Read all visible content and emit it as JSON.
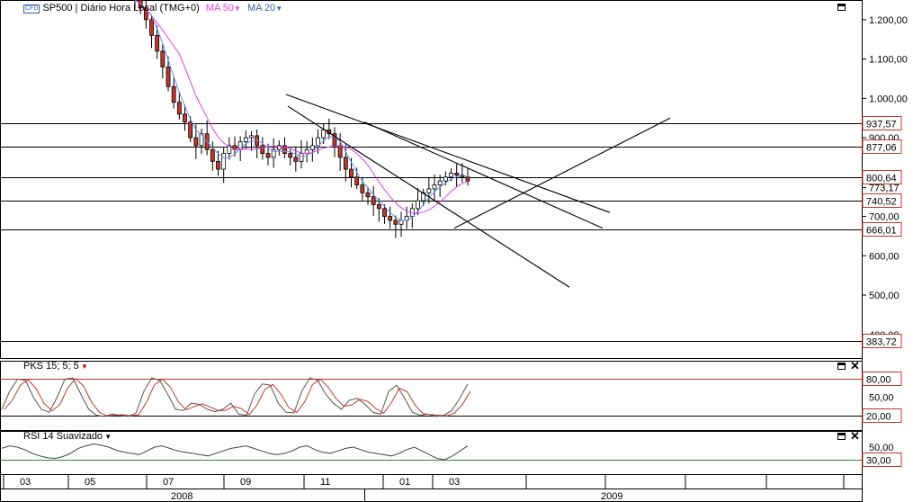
{
  "chart_data": {
    "type": "candlestick",
    "main": {
      "instrument": "SP500",
      "legend_text": "SP500 | Diário Hora Local (TMG+0)",
      "ma_labels": [
        "MA 50",
        "MA 20"
      ],
      "ma_colors": [
        "#e040e0",
        "#6f8fe6"
      ],
      "price_ticks": [
        "1.200,00",
        "1.100,00",
        "1.000,00",
        "900,00",
        "773,17",
        "700,00",
        "600,00",
        "500,00",
        "400,00"
      ],
      "price_tick_values": [
        1200,
        1100,
        1000,
        900,
        773.17,
        700,
        600,
        500,
        400
      ],
      "ylim": [
        340,
        1250
      ],
      "horizontal_levels": [
        "937,57",
        "877,06",
        "800,64",
        "740,52",
        "666,01",
        "383,72"
      ],
      "horizontal_level_values": [
        937.57,
        877.06,
        800.64,
        740.52,
        666.01,
        383.72
      ],
      "price_path": [
        1250,
        1230,
        1200,
        1160,
        1120,
        1080,
        1030,
        990,
        960,
        940,
        900,
        880,
        910,
        870,
        840,
        820,
        860,
        880,
        870,
        890,
        900,
        905,
        880,
        860,
        850,
        870,
        880,
        860,
        850,
        840,
        860,
        870,
        880,
        900,
        920,
        910,
        880,
        850,
        820,
        800,
        780,
        760,
        750,
        730,
        720,
        700,
        690,
        680,
        690,
        700,
        720,
        740,
        760,
        770,
        780,
        790,
        800,
        810,
        805,
        800,
        790
      ]
    },
    "pks": {
      "label": "PKS 15; 5; 5",
      "ticks": [
        "50,00"
      ],
      "levels": [
        "80,00",
        "20,00"
      ],
      "level_values": [
        80,
        20
      ],
      "ylim": [
        0,
        100
      ],
      "series": [
        30,
        60,
        80,
        78,
        50,
        30,
        25,
        50,
        80,
        82,
        55,
        30,
        20,
        18,
        22,
        20,
        18,
        24,
        60,
        82,
        78,
        55,
        30,
        28,
        40,
        38,
        30,
        26,
        30,
        40,
        22,
        20,
        55,
        72,
        70,
        40,
        25,
        24,
        60,
        82,
        78,
        55,
        40,
        30,
        45,
        48,
        38,
        25,
        22,
        60,
        70,
        48,
        25,
        20,
        22,
        18,
        20,
        28,
        48,
        72
      ]
    },
    "rsi": {
      "label": "RSI 14 Suavizado",
      "ticks": [
        "50,00"
      ],
      "levels": [
        "30,00"
      ],
      "level_values": [
        30
      ],
      "ylim": [
        10,
        70
      ],
      "series": [
        48,
        52,
        50,
        46,
        40,
        36,
        33,
        32,
        35,
        40,
        48,
        52,
        55,
        53,
        50,
        45,
        42,
        40,
        38,
        44,
        50,
        52,
        48,
        44,
        42,
        40,
        38,
        36,
        40,
        44,
        48,
        50,
        52,
        48,
        44,
        40,
        38,
        40,
        44,
        50,
        52,
        46,
        42,
        40,
        44,
        48,
        50,
        46,
        42,
        40,
        38,
        36,
        40,
        46,
        50,
        44,
        38,
        32,
        30,
        36,
        44,
        52
      ]
    },
    "x_axis": {
      "months": [
        "03",
        "05",
        "07",
        "09",
        "11",
        "01",
        "03"
      ],
      "years": [
        "2008",
        "2009"
      ]
    }
  }
}
